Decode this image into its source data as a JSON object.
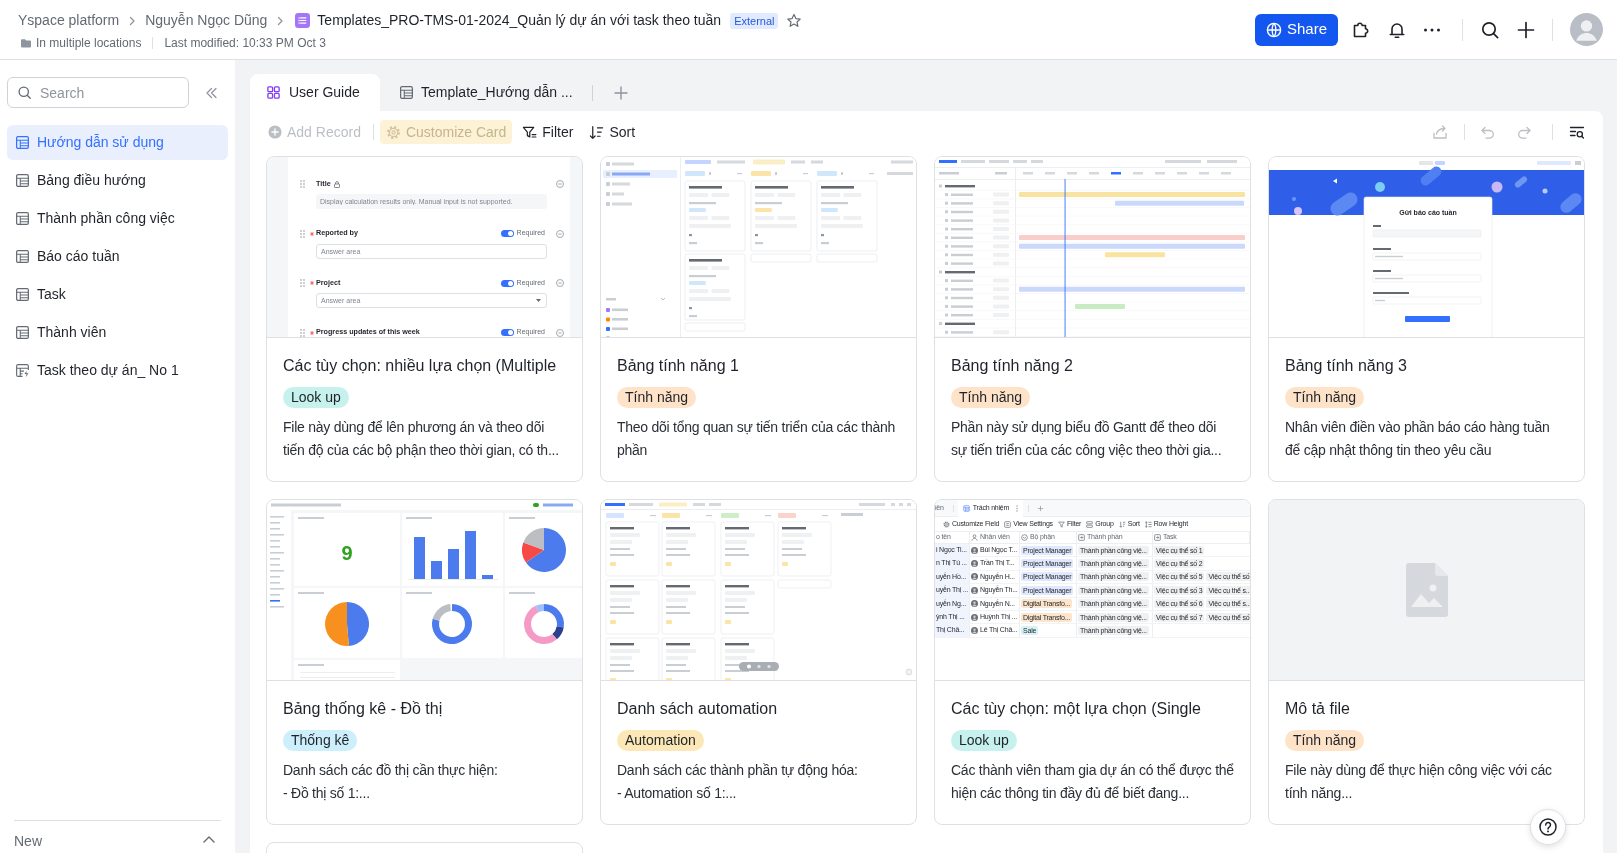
{
  "header": {
    "breadcrumbs": [
      "Yspace platform",
      "Nguyễn Ngọc Dũng"
    ],
    "title": "Templates_PRO-TMS-01-2024_Quản lý dự án với task theo tuần",
    "badge": "External",
    "starred": false,
    "location": "In multiple locations",
    "last_modified": "Last modified: 10:33 PM Oct 3",
    "share_button": "Share"
  },
  "sidebar": {
    "search": {
      "placeholder": "Search"
    },
    "items": [
      {
        "label": "Hướng dẫn sử dụng",
        "kind": "table",
        "selected": true
      },
      {
        "label": "Bảng điều hướng",
        "kind": "table",
        "selected": false
      },
      {
        "label": "Thành phần công việc",
        "kind": "table",
        "selected": false
      },
      {
        "label": "Báo cáo tuần",
        "kind": "table",
        "selected": false
      },
      {
        "label": "Task",
        "kind": "table",
        "selected": false
      },
      {
        "label": "Thành viên",
        "kind": "table",
        "selected": false
      },
      {
        "label": "Task theo dự án_ No 1",
        "kind": "automation",
        "selected": false
      }
    ],
    "footer": "New"
  },
  "tabs": [
    {
      "label": "User Guide",
      "kind": "gallery",
      "selected": true
    },
    {
      "label": "Template_Hướng dẫn ...",
      "kind": "grid",
      "selected": false
    }
  ],
  "toolbar": [
    {
      "label": "Add Record",
      "kind": "add",
      "disabled": true,
      "highlighted": false
    },
    {
      "label": "Customize Card",
      "kind": "customize",
      "disabled": true,
      "highlighted": true
    },
    {
      "label": "Filter",
      "kind": "filter",
      "disabled": false,
      "highlighted": false
    },
    {
      "label": "Sort",
      "kind": "sort",
      "disabled": false,
      "highlighted": false
    }
  ],
  "cards": [
    {
      "thumbnail": {
        "kind": "form",
        "fields": [
          {
            "label": "Title",
            "kind": "locked",
            "placeholder": "Display calculation results only. Manual input is not supported."
          },
          {
            "label": "Reported by",
            "kind": "text",
            "required": true,
            "required_label": "Required",
            "placeholder": "Answer area"
          },
          {
            "label": "Project",
            "kind": "select",
            "required": true,
            "required_label": "Required",
            "placeholder": "Answer area"
          },
          {
            "label": "Progress updates of this week",
            "kind": "text",
            "required": true,
            "required_label": "Required"
          }
        ]
      },
      "title": "Các tùy chọn: nhiều lựa chọn (Multiple",
      "tag": {
        "label": "Look up",
        "color": "#c6f1ec"
      },
      "description": "File này dùng để lên phương án và theo dõi tiến độ của các bộ phận theo thời gian, có th..."
    },
    {
      "thumbnail": {
        "kind": "kanban"
      },
      "title": "Bảng tính năng 1",
      "tag": {
        "label": "Tính năng",
        "color": "#fee3c8"
      },
      "description": "Theo dõi tổng quan sự tiến triển của các thành phần"
    },
    {
      "thumbnail": {
        "kind": "gantt"
      },
      "title": "Bảng tính năng 2",
      "tag": {
        "label": "Tính năng",
        "color": "#fee3c8"
      },
      "description": "Phần này sử dụng biểu đồ Gantt để theo dõi sự tiến triển của các công việc theo thời gia..."
    },
    {
      "thumbnail": {
        "kind": "survey",
        "form_title": "Gửi báo cáo tuần"
      },
      "title": "Bảng tính năng 3",
      "tag": {
        "label": "Tính năng",
        "color": "#fee3c8"
      },
      "description": "Nhân viên điền vào phần báo cáo hàng tuần để cập nhật thông tin theo yêu cầu"
    },
    {
      "thumbnail": {
        "kind": "dashboard",
        "stat": "9"
      },
      "title": "Bảng thống kê - Đồ thị",
      "tag": {
        "label": "Thống kê",
        "color": "#cdeefb"
      },
      "description": "Danh sách các đồ thị cần thực hiện:\n- Đồ thị số 1:..."
    },
    {
      "thumbnail": {
        "kind": "board"
      },
      "title": "Danh sách automation",
      "tag": {
        "label": "Automation",
        "color": "#fbe8b6"
      },
      "description": "Danh sách các thành phần tự động hóa:\n- Automation số 1:..."
    },
    {
      "thumbnail": {
        "kind": "table",
        "tabs": [
          {
            "label": "iên",
            "selected": false
          },
          {
            "label": "Trách nhiệm",
            "selected": true
          }
        ],
        "actions": [
          {
            "label": "Customize Field",
            "kind": "customize"
          },
          {
            "label": "View Settings",
            "kind": "settings"
          },
          {
            "label": "Filter",
            "kind": "filter"
          },
          {
            "label": "Group",
            "kind": "group"
          },
          {
            "label": "Sort",
            "kind": "sort"
          },
          {
            "label": "Row Height",
            "kind": "height"
          }
        ],
        "columns": [
          {
            "label": "o tên",
            "kind": "text"
          },
          {
            "label": "Nhân viên",
            "kind": "person"
          },
          {
            "label": "Bộ phận",
            "kind": "option"
          },
          {
            "label": "Thành phần",
            "kind": "link"
          },
          {
            "label": "Task",
            "kind": "link"
          }
        ],
        "rows": [
          {
            "column_1": "i Ngọc Ti...",
            "member": "Bùi Ngọc T...",
            "department": {
              "label": "Project Manager",
              "color": "#dfe8fd"
            },
            "component": "Thành phần công việ...",
            "tasks": [
              "Việc cụ thể số 1"
            ]
          },
          {
            "column_1": "n Thị Tú ...",
            "member": "Trần Thị T...",
            "department": {
              "label": "Project Manager",
              "color": "#dfe8fd"
            },
            "component": "Thành phần công việ...",
            "tasks": [
              "Việc cụ thể số 2"
            ]
          },
          {
            "column_1": "uyễn Hồ...",
            "member": "Nguyễn H...",
            "department": {
              "label": "Project Manager",
              "color": "#dfe8fd"
            },
            "component": "Thành phần công việ...",
            "tasks": [
              "Việc cụ thể số 5",
              "Việc cụ thể số"
            ]
          },
          {
            "column_1": "uyễn Thị ...",
            "member": "Nguyễn Th...",
            "department": {
              "label": "Project Manager",
              "color": "#dfe8fd"
            },
            "component": "Thành phần công việ...",
            "tasks": [
              "Việc cụ thể số 3",
              "Việc cụ thể s..."
            ]
          },
          {
            "column_1": "uyễn Ng...",
            "member": "Nguyễn N...",
            "department": {
              "label": "Digital Transfo...",
              "color": "#fde5cc"
            },
            "component": "Thành phần công việ...",
            "tasks": [
              "Việc cụ thể số 6",
              "Việc cụ thể s..."
            ]
          },
          {
            "column_1": "ỳnh Thị ...",
            "member": "Huỳnh Thị ...",
            "department": {
              "label": "Digital Transfo...",
              "color": "#fde5cc"
            },
            "component": "Thành phần công việ...",
            "tasks": [
              "Việc cụ thể số 7",
              "Việc cụ thể số"
            ]
          },
          {
            "column_1": "Thị Châ...",
            "member": "Lê Thị Châ...",
            "department": {
              "label": "Sale",
              "color": "#d5f3f7"
            },
            "component": "Thành phần công việ...",
            "tasks": []
          }
        ]
      },
      "title": "Các tùy chọn: một lựa chọn (Single",
      "tag": {
        "label": "Look up",
        "color": "#c6f1ec"
      },
      "description": "Các thành viên tham gia dự án có thể được thể hiện các thông tin đầy đủ để biết đang..."
    },
    {
      "thumbnail": {
        "kind": "empty"
      },
      "title": "Mô tả file",
      "tag": {
        "label": "Tính năng",
        "color": "#fee3c8"
      },
      "description": "File này dùng để thực hiện công việc với các tính năng..."
    }
  ]
}
